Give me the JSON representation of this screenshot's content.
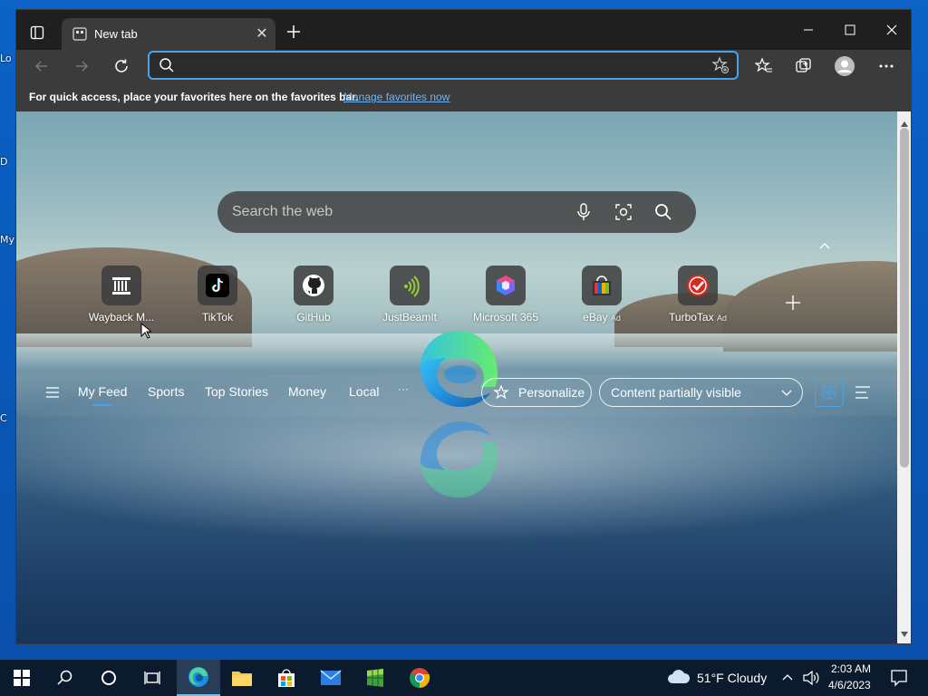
{
  "desktop": {
    "labels": [
      "Lo",
      "D",
      "My",
      "C"
    ]
  },
  "window": {
    "tab_title": "New tab",
    "address": {
      "value": "",
      "placeholder": ""
    },
    "favorites_bar": {
      "message": "For quick access, place your favorites here on the favorites bar.",
      "link": "Manage favorites now"
    }
  },
  "newtab": {
    "search_placeholder": "Search the web",
    "tiles": [
      {
        "label": "Wayback M...",
        "ad": "",
        "icon": "wayback-icon"
      },
      {
        "label": "TikTok",
        "ad": "",
        "icon": "tiktok-icon"
      },
      {
        "label": "GitHub",
        "ad": "",
        "icon": "github-icon"
      },
      {
        "label": "JustBeamIt",
        "ad": "",
        "icon": "justbeamit-icon"
      },
      {
        "label": "Microsoft 365",
        "ad": "",
        "icon": "microsoft365-icon"
      },
      {
        "label": "eBay",
        "ad": "Ad",
        "icon": "ebay-icon"
      },
      {
        "label": "TurboTax",
        "ad": "Ad",
        "icon": "turbotax-icon"
      }
    ],
    "feed_tabs": [
      "My Feed",
      "Sports",
      "Top Stories",
      "Money",
      "Local"
    ],
    "more": "···",
    "personalize": "Personalize",
    "visibility": "Content partially visible"
  },
  "taskbar": {
    "weather": "51°F  Cloudy",
    "time": "2:03 AM",
    "date": "4/6/2023"
  },
  "colors": {
    "accent": "#4aa3e8",
    "taskbar": "#0c1a2e",
    "chrome": "#3b3b3b"
  }
}
